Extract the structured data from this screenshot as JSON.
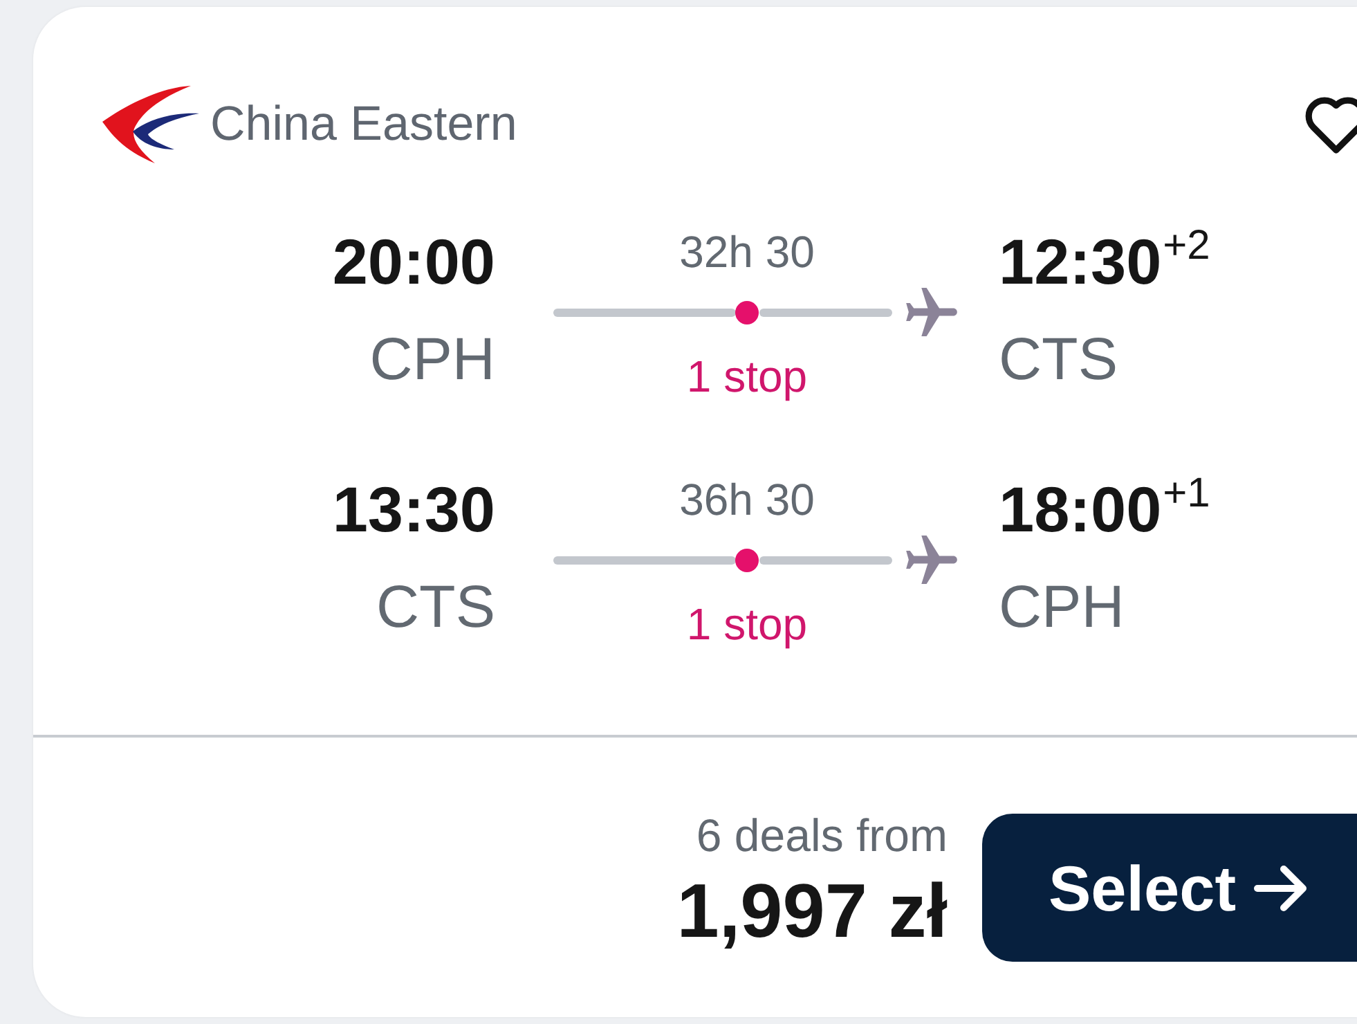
{
  "airline": {
    "name": "China Eastern"
  },
  "favorite": {
    "saved": false
  },
  "legs": [
    {
      "depart_time": "20:00",
      "depart_airport": "CPH",
      "duration": "32h 30",
      "stops": "1 stop",
      "arrive_time": "12:30$^{+2}$",
      "arrive_airport": "CTS"
    },
    {
      "depart_time": "13:30",
      "depart_airport": "CTS",
      "duration": "36h 30",
      "stops": "1 stop",
      "arrive_time": "18:00$^{+1}$",
      "arrive_airport": "CPH"
    }
  ],
  "price": {
    "deals": "6 deals from",
    "amount": "1,997 zł"
  },
  "button": {
    "label": "Select"
  }
}
